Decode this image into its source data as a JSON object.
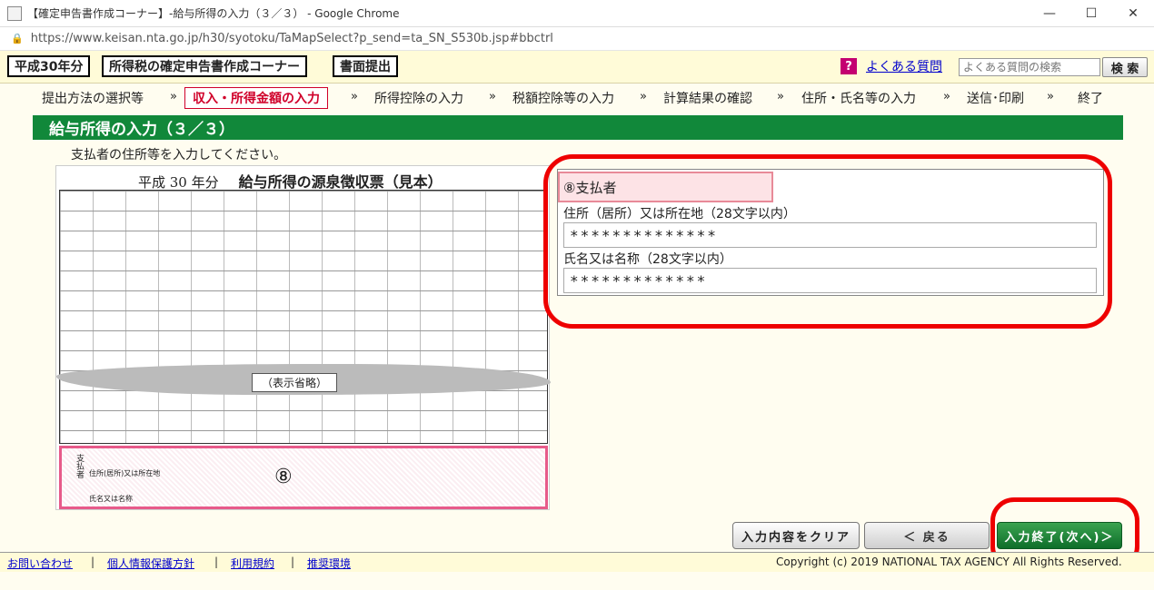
{
  "browser": {
    "tab_title": "【確定申告書作成コーナー】-給与所得の入力（３／３） - Google Chrome",
    "url": "https://www.keisan.nta.go.jp/h30/syotoku/TaMapSelect?p_send=ta_SN_S530b.jsp#bbctrl",
    "minimize": "—",
    "maximize": "☐",
    "close": "✕",
    "lock": "🔒"
  },
  "header": {
    "year_label": "平成30年分",
    "corner_label": "所得税の確定申告書作成コーナー",
    "doc_label": "書面提出",
    "help_icon": "?",
    "faq_link": "よくある質問",
    "faq_placeholder": "よくある質問の検索",
    "search_button": "検 索"
  },
  "steps": {
    "s1": "提出方法の選択等",
    "s2": "収入・所得金額の入力",
    "s3": "所得控除の入力",
    "s4": "税額控除等の入力",
    "s5": "計算結果の確認",
    "s6": "住所・氏名等の入力",
    "s7": "送信･印刷",
    "s8": "終了",
    "sep": "»"
  },
  "section": {
    "heading": "給与所得の入力（３／３）",
    "instruction": "支払者の住所等を入力してください。"
  },
  "sample": {
    "title_prefix": "平成 30 年分",
    "title_main": "給与所得の源泉徴収票（見本）",
    "omitted": "（表示省略）",
    "payer_side": "支払者",
    "address_small": "住所(居所)又は所在地",
    "name_small": "氏名又は名称",
    "marker": "⑧"
  },
  "payer_form": {
    "heading": "⑧支払者",
    "address_label": "住所（居所）又は所在地（28文字以内）",
    "address_value": "**************",
    "name_label": "氏名又は名称（28文字以内）",
    "name_value": "*************"
  },
  "buttons": {
    "clear": "入力内容をクリア",
    "back": "＜ 戻る",
    "next": "入力終了(次へ)＞"
  },
  "footer": {
    "contact": "お問い合わせ",
    "privacy": "個人情報保護方針",
    "terms": "利用規約",
    "env": "推奨環境",
    "sep": "|",
    "copyright": "Copyright (c) 2019 NATIONAL TAX AGENCY All Rights Reserved."
  },
  "colors": {
    "section_green": "#11883a",
    "active_red": "#d0002a",
    "highlight_red": "#ee0000"
  }
}
